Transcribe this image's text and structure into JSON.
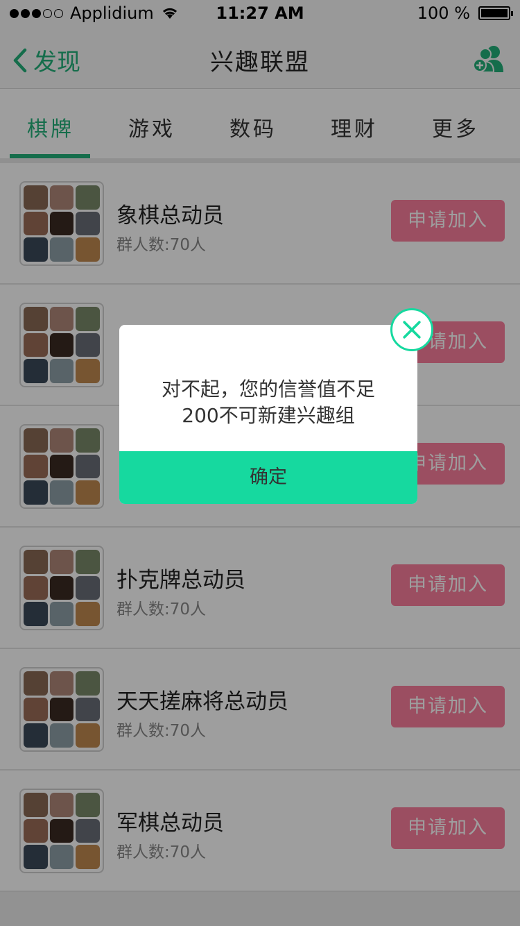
{
  "status_bar": {
    "carrier": "Applidium",
    "time": "11:27 AM",
    "battery": "100 %"
  },
  "nav": {
    "back_label": "发现",
    "title": "兴趣联盟",
    "action_icon": "add-group-icon",
    "accent": "#22b07a"
  },
  "tabs": [
    {
      "label": "棋牌",
      "active": true
    },
    {
      "label": "游戏",
      "active": false
    },
    {
      "label": "数码",
      "active": false
    },
    {
      "label": "理财",
      "active": false
    },
    {
      "label": "更多",
      "active": false
    }
  ],
  "groups": [
    {
      "name": "象棋总动员",
      "count": "群人数:70人",
      "button": "申请加入"
    },
    {
      "name": "",
      "count": "",
      "button": "申请加入"
    },
    {
      "name": "",
      "count": "",
      "button": "申请加入"
    },
    {
      "name": "扑克牌总动员",
      "count": "群人数:70人",
      "button": "申请加入"
    },
    {
      "name": "天天搓麻将总动员",
      "count": "群人数:70人",
      "button": "申请加入"
    },
    {
      "name": "军棋总动员",
      "count": "群人数:70人",
      "button": "申请加入"
    }
  ],
  "dialog": {
    "message_line1": "对不起，您的信誉值不足",
    "message_line2": "200不可新建兴趣组",
    "confirm_label": "确定",
    "accent": "#16d99f"
  },
  "colors": {
    "join_button": "#fb7f9d",
    "tab_active": "#22b07a"
  }
}
